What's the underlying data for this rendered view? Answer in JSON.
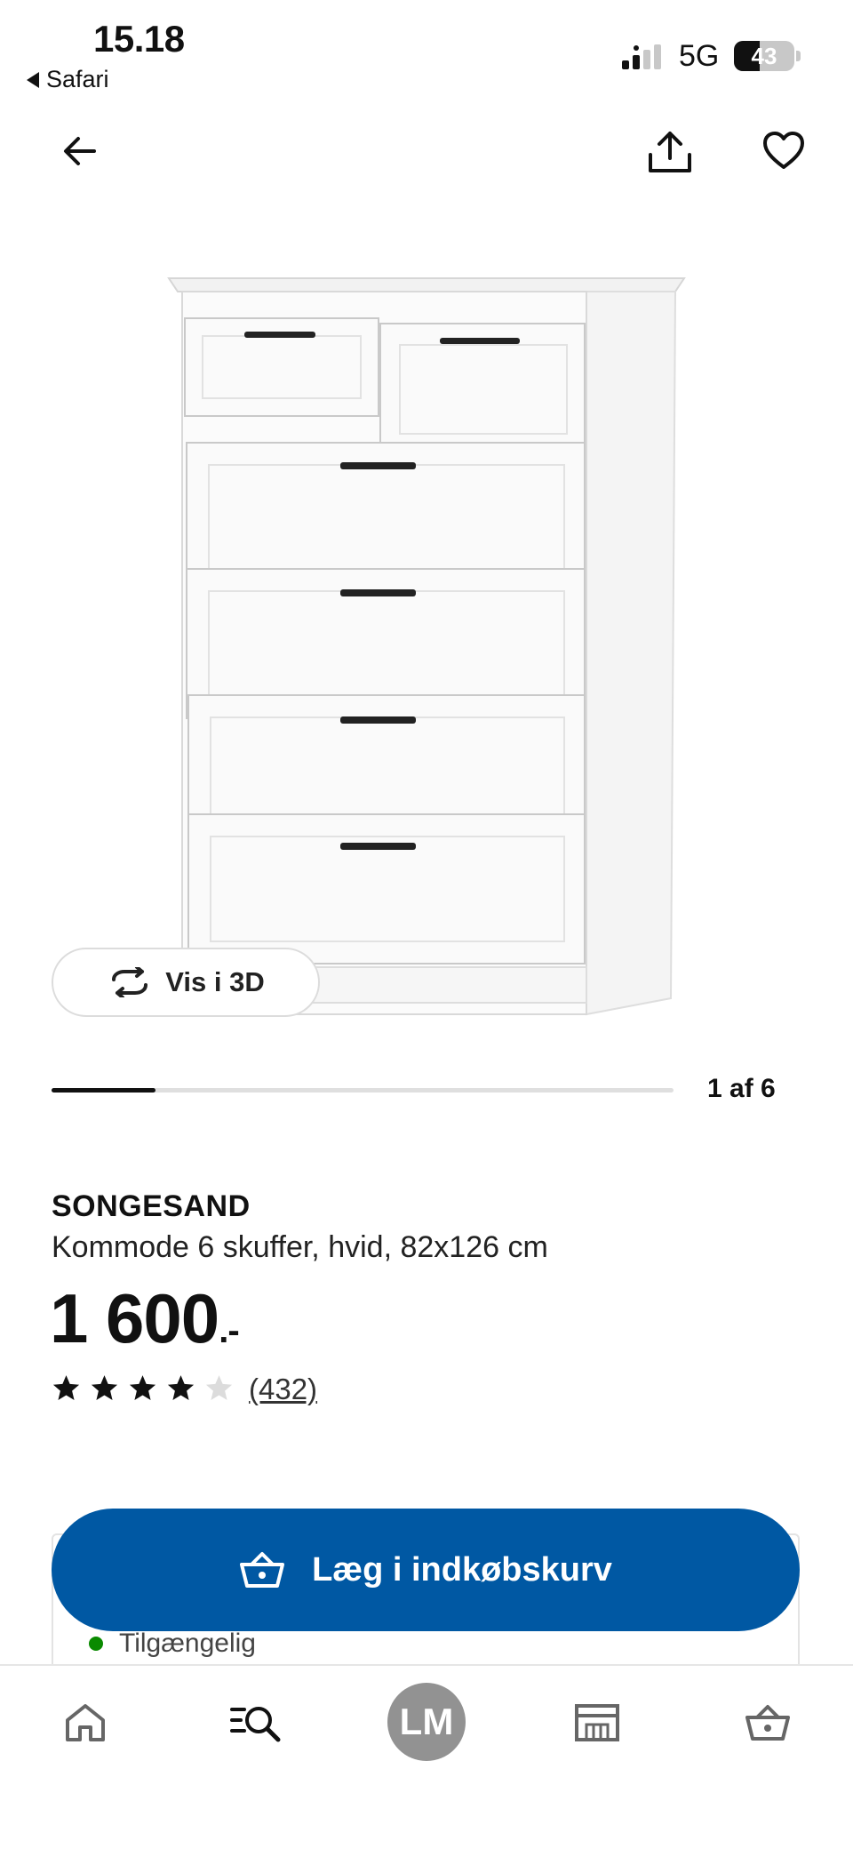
{
  "status_bar": {
    "time": "15.18",
    "back_app": "Safari",
    "network": "5G",
    "battery_percent": "43",
    "battery_level": 0.43
  },
  "nav": {
    "back_icon": "arrow-left-icon",
    "share_icon": "share-icon",
    "favorite_icon": "heart-icon"
  },
  "gallery": {
    "view3d_label": "Vis i 3D",
    "counter": "1 af 6",
    "current": 1,
    "total": 6
  },
  "product": {
    "brand": "SONGESAND",
    "description": "Kommode 6 skuffer, hvid, 82x126 cm",
    "price_main": "1 600",
    "price_suffix": ".-",
    "rating": 4,
    "rating_max": 5,
    "review_count": "(432)"
  },
  "purchase": {
    "add_to_cart_label": "Læg i indkøbskurv",
    "availability": "Tilgængelig",
    "button_color": "#0058a3",
    "availability_color": "#0a8a00"
  },
  "tabbar": {
    "items": [
      "home-icon",
      "search-icon",
      "profile-avatar",
      "store-icon",
      "basket-icon"
    ],
    "avatar_initials": "LM"
  }
}
